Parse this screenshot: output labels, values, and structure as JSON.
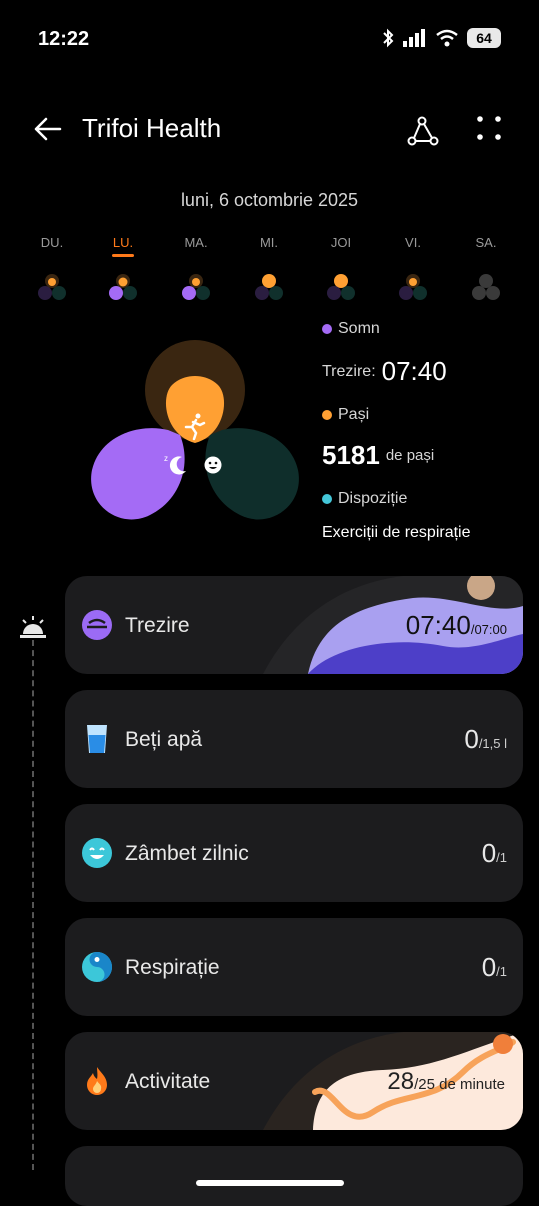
{
  "status_bar": {
    "time": "12:22",
    "battery": "64"
  },
  "header": {
    "title": "Trifoi Health"
  },
  "date": "luni, 6 octombrie 2025",
  "days": [
    "DU.",
    "LU.",
    "MA.",
    "MI.",
    "JOI",
    "VI.",
    "SA."
  ],
  "active_day_index": 1,
  "legend": {
    "sleep": {
      "label": "Somn",
      "caption": "Trezire:",
      "value": "07:40"
    },
    "steps": {
      "label": "Pași",
      "value": "5181",
      "unit": "de pași"
    },
    "mood": {
      "label": "Dispoziție",
      "text": "Exerciții de respirație"
    }
  },
  "cards": [
    {
      "label": "Trezire",
      "value": "07:40",
      "target": "/07:00",
      "icon": "wake-icon"
    },
    {
      "label": "Beți apă",
      "value": "0",
      "target": "/1,5 l",
      "icon": "water-glass-icon"
    },
    {
      "label": "Zâmbet zilnic",
      "value": "0",
      "target": "/1",
      "icon": "smile-icon"
    },
    {
      "label": "Respirație",
      "value": "0",
      "target": "/1",
      "icon": "breathing-icon"
    },
    {
      "label": "Activitate",
      "value": "28",
      "target": "/25 de minute",
      "icon": "flame-icon"
    }
  ],
  "colors": {
    "sleep": "#a46bf5",
    "steps": "#ffa033",
    "mood": "#44c6d8",
    "accent": "#ff7a1a"
  }
}
